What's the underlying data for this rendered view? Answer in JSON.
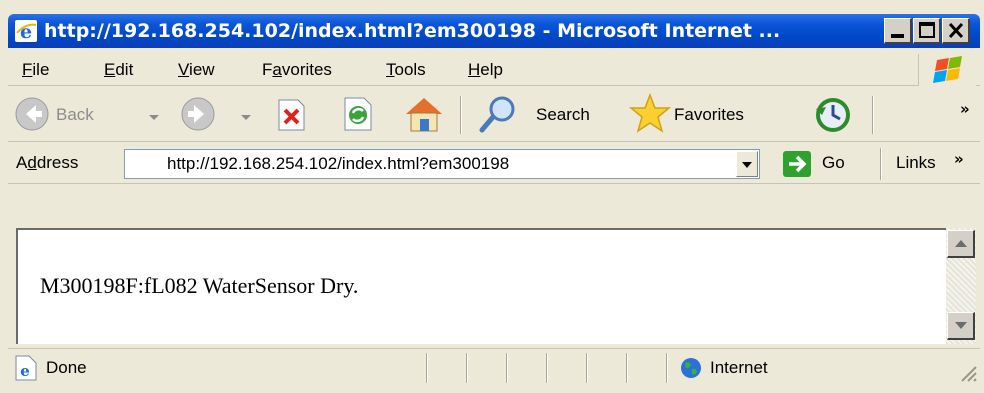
{
  "window": {
    "title": "http://192.168.254.102/index.html?em300198 - Microsoft Internet ..."
  },
  "menu": {
    "items": [
      {
        "key": "F",
        "rest": "ile"
      },
      {
        "key": "E",
        "rest": "dit"
      },
      {
        "key": "V",
        "rest": "iew"
      },
      {
        "pre": "F",
        "key": "a",
        "rest": "vorites"
      },
      {
        "key": "T",
        "rest": "ools"
      },
      {
        "key": "H",
        "rest": "elp"
      }
    ]
  },
  "toolbar": {
    "back_label": "Back",
    "search_label": "Search",
    "favorites_label": "Favorites",
    "overflow": "»"
  },
  "address": {
    "label_pre": "A",
    "label_key": "d",
    "label_rest": "dress",
    "url": "http://192.168.254.102/index.html?em300198",
    "go_label": "Go",
    "links_label": "Links",
    "links_overflow": "»"
  },
  "content": {
    "text": "M300198F:fL082 WaterSensor Dry."
  },
  "status": {
    "text": "Done",
    "zone": "Internet"
  },
  "colors": {
    "titlebar": "#0a55d6",
    "chrome": "#ece9d8"
  }
}
